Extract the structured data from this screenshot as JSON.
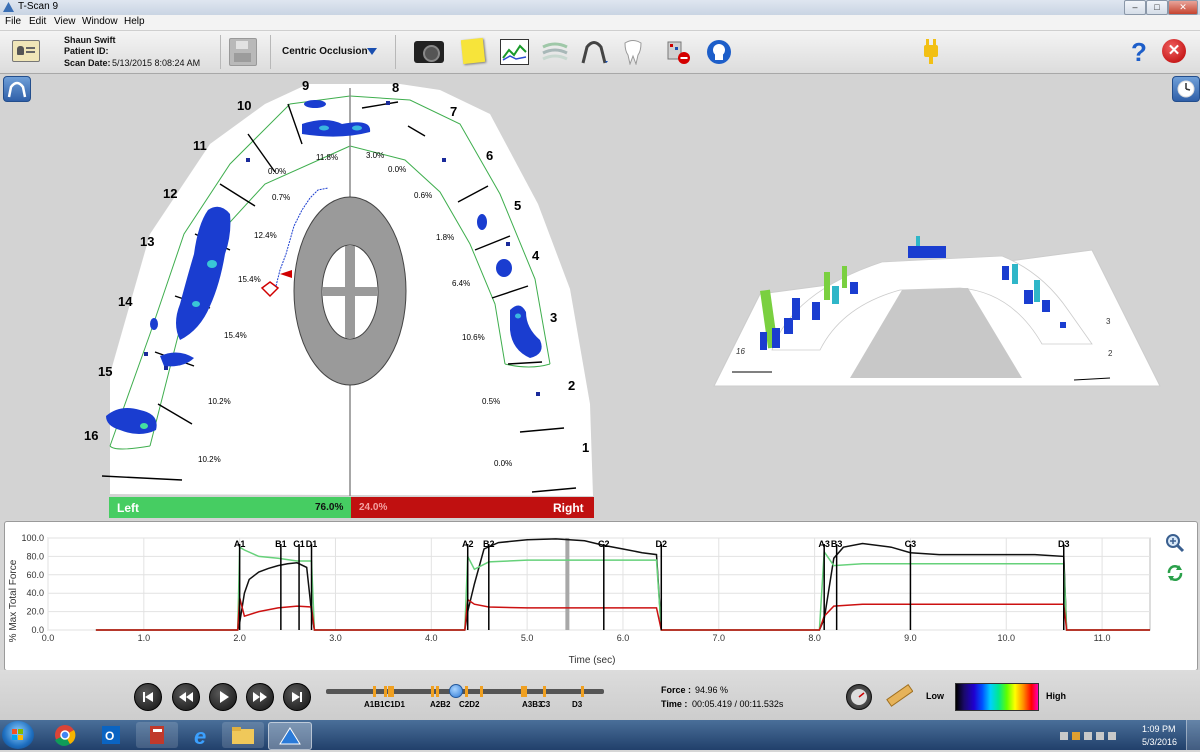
{
  "window": {
    "title": "T-Scan 9",
    "minimize": "–",
    "maximize": "□",
    "close": "✕"
  },
  "menu": [
    "File",
    "Edit",
    "View",
    "Window",
    "Help"
  ],
  "patient": {
    "name": "Shaun Swift",
    "id_label": "Patient ID:",
    "scan_label": "Scan Date:",
    "scan_date": "5/13/2015 8:08:24 AM"
  },
  "toolbar": {
    "occlusion_mode": "Centric Occlusion",
    "icons": [
      "save-icon",
      "camera-icon",
      "sticky-note-icon",
      "graph-icon",
      "layers-icon",
      "arch-icon",
      "tooth-icon",
      "sensor-icon",
      "head-icon",
      "plugin-icon",
      "help-icon",
      "close-icon"
    ]
  },
  "arch": {
    "left_teeth": [
      "9",
      "10",
      "11",
      "12",
      "13",
      "14",
      "15",
      "16"
    ],
    "right_teeth": [
      "8",
      "7",
      "6",
      "5",
      "4",
      "3",
      "2",
      "1"
    ],
    "left_percents": [
      "11.8%",
      "0.0%",
      "0.7%",
      "12.4%",
      "15.4%",
      "15.4%",
      "10.2%",
      "10.2%"
    ],
    "right_percents": [
      "3.0%",
      "0.0%",
      "0.6%",
      "1.8%",
      "6.4%",
      "10.6%",
      "0.5%",
      "0.0%"
    ],
    "left_label": "Left",
    "left_value": "76.0%",
    "right_label": "Right",
    "right_value": "24.0%",
    "colors": {
      "left": "#3fcf5a",
      "right": "#cc1111"
    }
  },
  "graph": {
    "ylabel": "% Max Total Force",
    "xlabel": "Time (sec)",
    "yticks": [
      "100.0",
      "80.0",
      "60.0",
      "40.0",
      "20.0",
      "0.0"
    ],
    "xticks": [
      "0.0",
      "1.0",
      "2.0",
      "3.0",
      "4.0",
      "5.0",
      "6.0",
      "7.0",
      "8.0",
      "9.0",
      "10.0",
      "11.0"
    ],
    "markers": [
      {
        "label": "A1",
        "t": 2.0
      },
      {
        "label": "B1",
        "t": 2.43
      },
      {
        "label": "C1",
        "t": 2.62
      },
      {
        "label": "D1",
        "t": 2.75
      },
      {
        "label": "A2",
        "t": 4.38
      },
      {
        "label": "B2",
        "t": 4.6
      },
      {
        "label": "C2",
        "t": 5.8
      },
      {
        "label": "D2",
        "t": 6.4
      },
      {
        "label": "A3",
        "t": 8.1
      },
      {
        "label": "B3",
        "t": 8.23
      },
      {
        "label": "C3",
        "t": 9.0
      },
      {
        "label": "D3",
        "t": 10.6
      }
    ],
    "cursor_t": 5.42
  },
  "playback": {
    "force_label": "Force :",
    "force_value": "94.96 %",
    "time_label": "Time :",
    "time_value": "00:05.419 / 00:11.532s",
    "timeline_labels": [
      "A1B1C1D1",
      "A2B2",
      "C2D2",
      "A3B3",
      "C3",
      "D3"
    ],
    "legend_low": "Low",
    "legend_high": "High"
  },
  "taskbar": {
    "time": "1:09 PM",
    "date": "5/3/2016",
    "apps": [
      "chrome-icon",
      "outlook-icon",
      "files-icon",
      "ie-icon",
      "explorer-icon",
      "tscan-icon"
    ]
  },
  "chart_data": {
    "type": "line",
    "title": "",
    "xlabel": "Time (sec)",
    "ylabel": "% Max Total Force",
    "xlim": [
      0,
      11.5
    ],
    "ylim": [
      0,
      100
    ],
    "series": [
      {
        "color": "#111111",
        "x": [
          0.5,
          1.98,
          2.0,
          2.05,
          2.1,
          2.2,
          2.3,
          2.4,
          2.5,
          2.6,
          2.7,
          2.75,
          2.78,
          4.35,
          4.38,
          4.45,
          4.55,
          4.7,
          5.0,
          5.3,
          5.6,
          5.8,
          6.0,
          6.2,
          6.35,
          6.4,
          8.05,
          8.1,
          8.2,
          8.3,
          8.5,
          8.8,
          9.0,
          9.3,
          9.7,
          10.0,
          10.3,
          10.6,
          10.63,
          11.5
        ],
        "y": [
          0,
          0,
          8,
          40,
          55,
          63,
          67,
          70,
          72,
          73,
          68,
          20,
          0,
          0,
          20,
          50,
          88,
          95,
          98,
          99,
          97,
          92,
          88,
          84,
          82,
          0,
          0,
          12,
          78,
          90,
          94,
          90,
          84,
          82,
          82,
          82,
          82,
          80,
          0,
          0
        ]
      },
      {
        "color": "#66d17a",
        "x": [
          0.5,
          1.98,
          2.0,
          2.05,
          2.2,
          2.4,
          2.6,
          2.75,
          2.78,
          4.35,
          4.38,
          4.45,
          4.6,
          5.0,
          5.5,
          6.0,
          6.35,
          6.4,
          8.05,
          8.1,
          8.2,
          8.5,
          9.0,
          9.5,
          10.0,
          10.6,
          10.63,
          11.5
        ],
        "y": [
          0,
          0,
          90,
          87,
          80,
          78,
          75,
          75,
          0,
          0,
          80,
          66,
          74,
          76,
          76,
          76,
          76,
          0,
          0,
          85,
          70,
          72,
          72,
          72,
          72,
          72,
          0,
          0
        ]
      },
      {
        "color": "#cc1111",
        "x": [
          0.5,
          1.98,
          2.0,
          2.05,
          2.2,
          2.4,
          2.6,
          2.75,
          2.78,
          4.35,
          4.38,
          4.45,
          4.6,
          5.0,
          5.5,
          6.0,
          6.35,
          6.4,
          8.05,
          8.1,
          8.2,
          8.5,
          9.0,
          9.5,
          10.0,
          10.6,
          10.63,
          11.5
        ],
        "y": [
          0,
          0,
          35,
          15,
          20,
          24,
          26,
          25,
          0,
          0,
          33,
          28,
          25,
          24,
          24,
          24,
          24,
          0,
          0,
          15,
          26,
          28,
          28,
          28,
          28,
          28,
          0,
          0
        ]
      }
    ]
  }
}
